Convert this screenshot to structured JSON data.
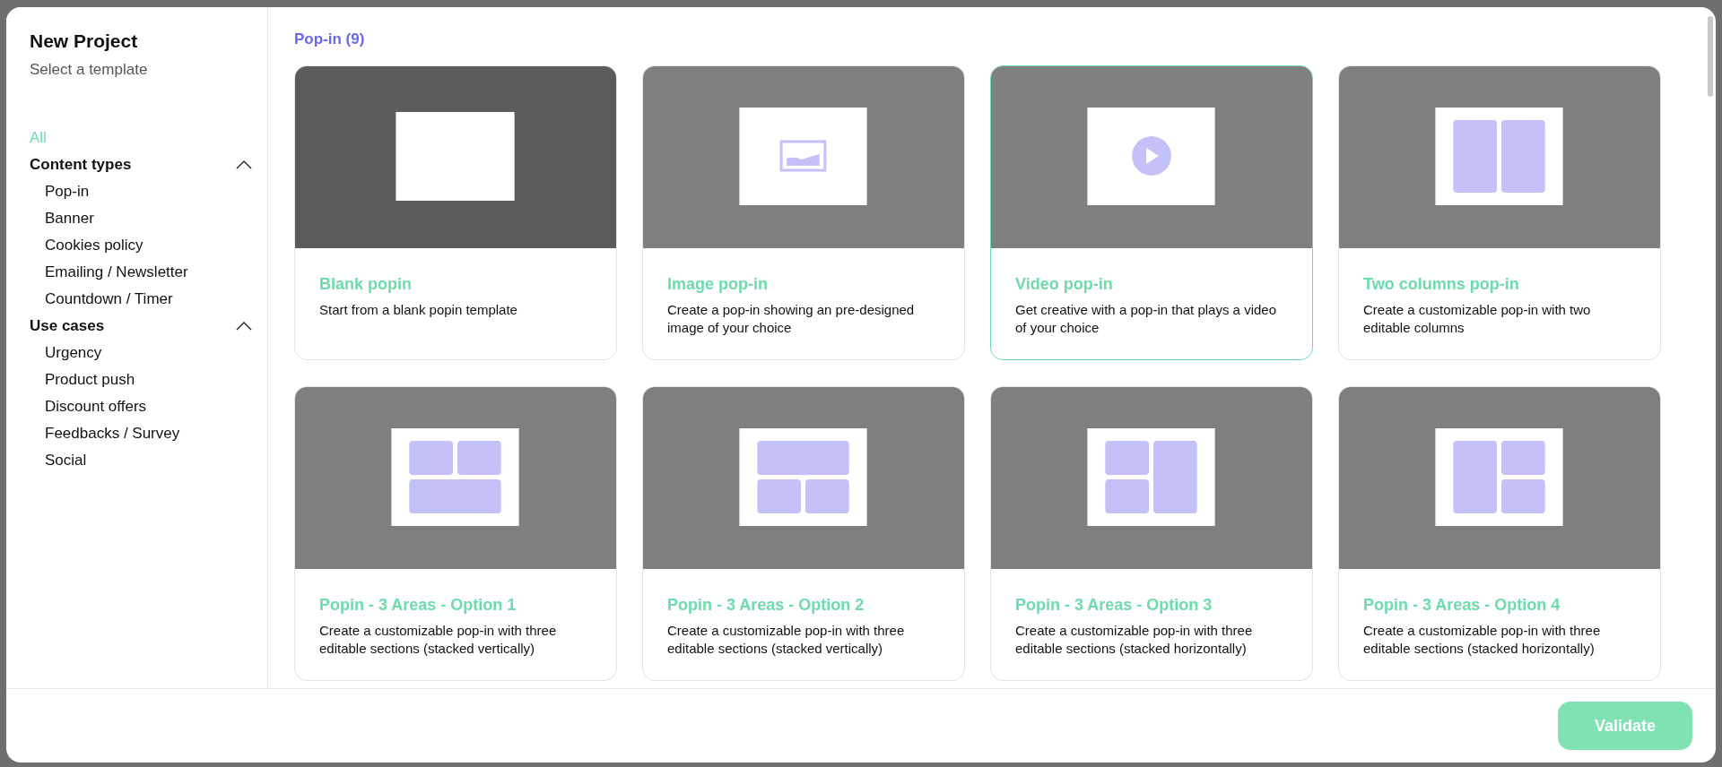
{
  "sidebar": {
    "title": "New Project",
    "subtitle": "Select a template",
    "all": {
      "label": "All",
      "selected": true
    },
    "groups": [
      {
        "label": "Content types",
        "expanded": true,
        "items": [
          {
            "label": "Pop-in",
            "selected": false
          },
          {
            "label": "Banner",
            "selected": false
          },
          {
            "label": "Cookies policy",
            "selected": false
          },
          {
            "label": "Emailing / Newsletter",
            "selected": false
          },
          {
            "label": "Countdown / Timer",
            "selected": false
          }
        ]
      },
      {
        "label": "Use cases",
        "expanded": true,
        "items": [
          {
            "label": "Urgency",
            "selected": false
          },
          {
            "label": "Product push",
            "selected": false
          },
          {
            "label": "Discount offers",
            "selected": false
          },
          {
            "label": "Feedbacks / Survey",
            "selected": false
          },
          {
            "label": "Social",
            "selected": false
          }
        ]
      }
    ]
  },
  "section": {
    "title": "Pop-in (9)"
  },
  "templates": [
    {
      "kind": "blank",
      "title": "Blank popin",
      "description": "Start from a blank popin template",
      "selected": false,
      "hovered": true
    },
    {
      "kind": "image",
      "title": "Image pop-in",
      "description": "Create a pop-in showing an pre-designed image of your choice",
      "selected": false,
      "hovered": false
    },
    {
      "kind": "video",
      "title": "Video pop-in",
      "description": "Get creative with a pop-in that plays a video of your choice",
      "selected": true,
      "hovered": false
    },
    {
      "kind": "two-columns",
      "title": "Two columns pop-in",
      "description": "Create a customizable pop-in with two editable columns",
      "selected": false,
      "hovered": false
    },
    {
      "kind": "three-1",
      "title": "Popin - 3 Areas - Option 1",
      "description": "Create a customizable pop-in with three editable sections (stacked vertically)",
      "selected": false,
      "hovered": false
    },
    {
      "kind": "three-2",
      "title": "Popin - 3 Areas - Option 2",
      "description": "Create a customizable pop-in with three editable sections (stacked vertically)",
      "selected": false,
      "hovered": false
    },
    {
      "kind": "three-3",
      "title": "Popin - 3 Areas - Option 3",
      "description": "Create a customizable pop-in with three editable sections (stacked horizontally)",
      "selected": false,
      "hovered": false
    },
    {
      "kind": "three-4",
      "title": "Popin - 3 Areas - Option 4",
      "description": "Create a customizable pop-in with three editable sections (stacked horizontally)",
      "selected": false,
      "hovered": false
    }
  ],
  "footer": {
    "button": {
      "label": "Validate",
      "disabled": true
    }
  }
}
